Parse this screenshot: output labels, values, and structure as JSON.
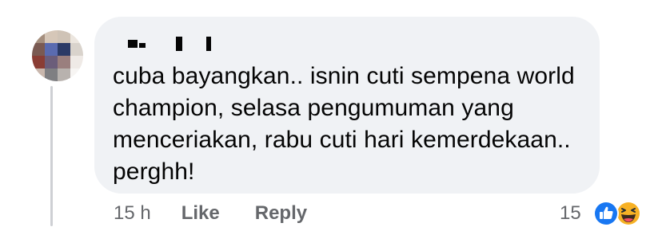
{
  "comment": {
    "text_lines": [
      "cuba bayangkan.. isnin cuti sempena world",
      "champion, selasa pengumuman yang",
      "menceriakan, rabu cuti hari kemerdekaan..",
      "perghh!"
    ],
    "timestamp": "15 h",
    "like_label": "Like",
    "reply_label": "Reply",
    "reaction_count": "15",
    "reactions": [
      "like-icon",
      "haha-icon"
    ]
  },
  "colors": {
    "bubble": "#f0f2f5",
    "text": "#050505",
    "meta": "#65676b",
    "like_blue": "#1877f2",
    "haha_yellow": "#f7b125"
  }
}
